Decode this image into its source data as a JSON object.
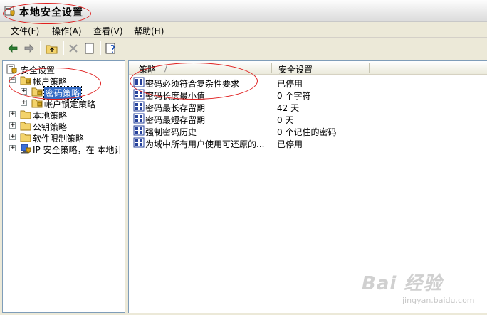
{
  "window": {
    "title": "本地安全设置"
  },
  "menu": [
    {
      "label": "文件(F)"
    },
    {
      "label": "操作(A)"
    },
    {
      "label": "查看(V)"
    },
    {
      "label": "帮助(H)"
    }
  ],
  "toolbar": {
    "buttons": [
      "back-arrow-icon",
      "forward-arrow-icon",
      "up-folder-icon",
      "delete-icon",
      "properties-icon",
      "help-icon"
    ]
  },
  "tree": {
    "root": "安全设置",
    "items": [
      {
        "label": "帐户策略",
        "expanded": true
      },
      {
        "label": "密码策略",
        "selected": true
      },
      {
        "label": "帐户锁定策略"
      },
      {
        "label": "本地策略"
      },
      {
        "label": "公钥策略"
      },
      {
        "label": "软件限制策略"
      },
      {
        "label": "IP 安全策略，在 本地计"
      }
    ]
  },
  "list": {
    "columns": [
      "策略",
      "安全设置"
    ],
    "sort_indicator": "/",
    "rows": [
      {
        "policy": "密码必须符合复杂性要求",
        "setting": "已停用"
      },
      {
        "policy": "密码长度最小值",
        "setting": "0 个字符"
      },
      {
        "policy": "密码最长存留期",
        "setting": "42 天"
      },
      {
        "policy": "密码最短存留期",
        "setting": "0 天"
      },
      {
        "policy": "强制密码历史",
        "setting": "0 个记住的密码"
      },
      {
        "policy": "为域中所有用户使用可还原的...",
        "setting": "已停用"
      }
    ]
  },
  "watermark": {
    "brand": "Bai 经验",
    "url": "jingyan.baidu.com"
  },
  "colors": {
    "selection": "#316ac5",
    "annotation": "#e02020"
  }
}
